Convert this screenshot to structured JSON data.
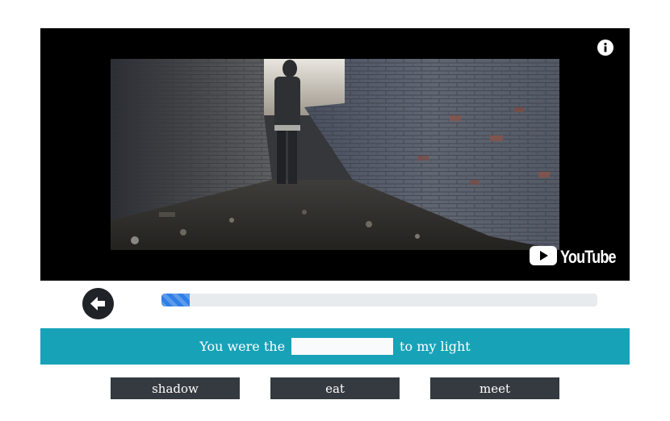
{
  "video": {
    "logo_text": "YouTube",
    "icons": {
      "info": "info-icon",
      "logo": "youtube-play-icon"
    }
  },
  "controls": {
    "back_icon": "arrow-left-circle-icon",
    "progress_fraction": 0.065
  },
  "exercise": {
    "sentence_before": "You were the",
    "blank_value": "",
    "sentence_after": "to my light"
  },
  "choices": [
    "shadow",
    "eat",
    "meet"
  ],
  "colors": {
    "video_bg": "#000000",
    "sentence_bar": "#17a2b8",
    "choice_button": "#343a40",
    "progress_fill": "#2f7fe6",
    "progress_track": "#e8ebee",
    "back_button": "#1f2226"
  }
}
